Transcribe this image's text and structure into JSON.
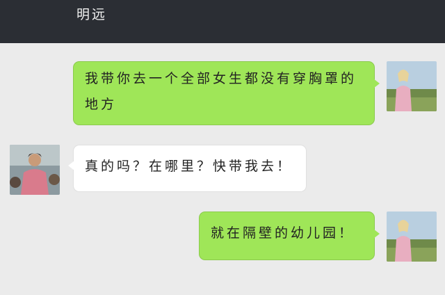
{
  "header": {
    "contact_name": "明远"
  },
  "messages": [
    {
      "direction": "outgoing",
      "text": "我带你去一个全部女生都没有穿胸罩的地方",
      "avatar": "avatar-girl-icon"
    },
    {
      "direction": "incoming",
      "text": "真的吗？在哪里？快带我去！",
      "avatar": "avatar-man-icon"
    },
    {
      "direction": "outgoing",
      "text": "就在隔壁的幼儿园！",
      "avatar": "avatar-girl-icon"
    }
  ],
  "colors": {
    "header_bg": "#2b2e34",
    "chat_bg": "#ebebeb",
    "outgoing_bubble": "#9fe658",
    "incoming_bubble": "#ffffff"
  }
}
